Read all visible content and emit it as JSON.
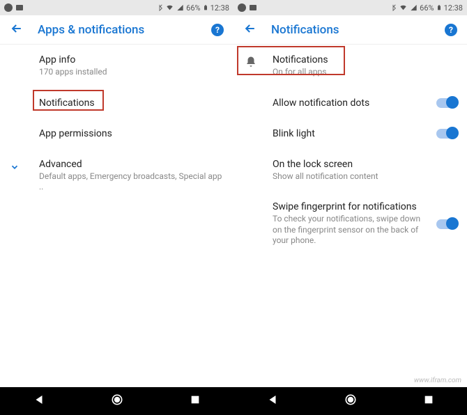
{
  "status": {
    "battery": "66%",
    "time": "12:38"
  },
  "left": {
    "title": "Apps & notifications",
    "items": [
      {
        "title": "App info",
        "sub": "170 apps installed"
      },
      {
        "title": "Notifications",
        "sub": ""
      },
      {
        "title": "App permissions",
        "sub": ""
      },
      {
        "title": "Advanced",
        "sub": "Default apps, Emergency broadcasts, Special app .."
      }
    ]
  },
  "right": {
    "title": "Notifications",
    "items": [
      {
        "title": "Notifications",
        "sub": "On for all apps"
      },
      {
        "title": "Allow notification dots",
        "sub": ""
      },
      {
        "title": "Blink light",
        "sub": ""
      },
      {
        "title": "On the lock screen",
        "sub": "Show all notification content"
      },
      {
        "title": "Swipe fingerprint for notifications",
        "sub": "To check your notifications, swipe down on the fingerprint sensor on the back of your phone."
      }
    ]
  },
  "watermark": "www.ifram.com"
}
